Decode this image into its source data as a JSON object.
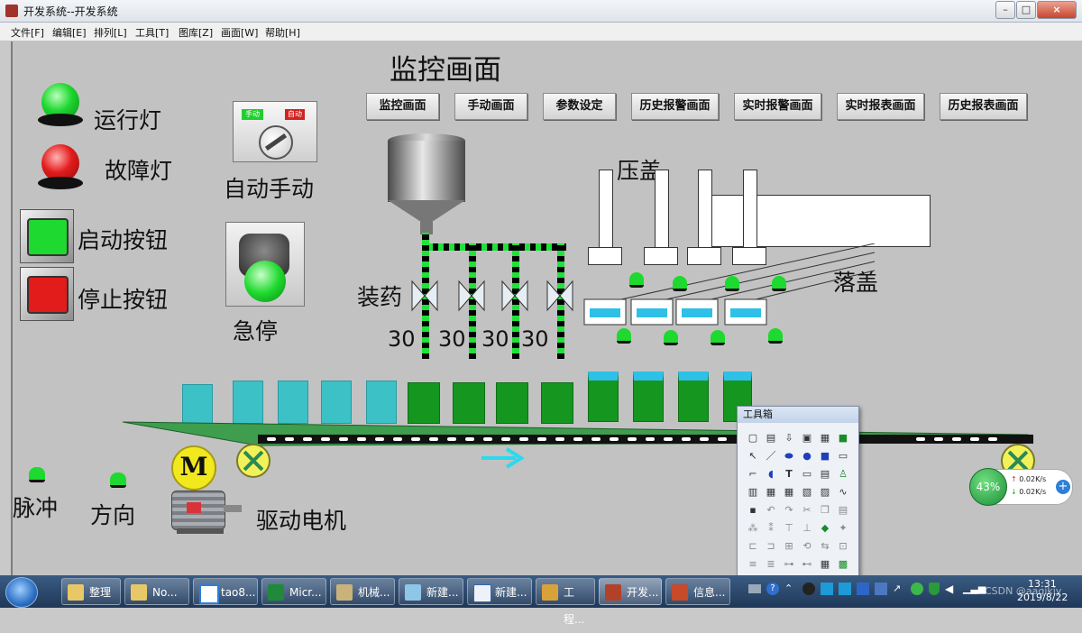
{
  "window": {
    "title": "开发系统--开发系统"
  },
  "menu": [
    "文件[F]",
    "编辑[E]",
    "排列[L]",
    "工具[T]",
    "图库[Z]",
    "画面[W]",
    "帮助[H]"
  ],
  "screen_title": "监控画面",
  "nav_buttons": [
    "监控画面",
    "手动画面",
    "参数设定",
    "历史报警画面",
    "实时报警画面",
    "实时报表画面",
    "历史报表画面"
  ],
  "lights": {
    "run": "运行灯",
    "fault": "故障灯"
  },
  "buttons": {
    "start": "启动按钮",
    "stop": "停止按钮"
  },
  "mode_switch": {
    "label": "自动手动",
    "manual_tag": "手动",
    "auto_tag": "自动"
  },
  "estop": "急停",
  "filling": {
    "label": "装药",
    "values": [
      "30",
      "30",
      "30",
      "30"
    ]
  },
  "press": "压盖",
  "drop_cap": "落盖",
  "motor": {
    "label": "驱动电机",
    "badge": "M"
  },
  "pulse": "脉冲",
  "direction": "方向",
  "toolbox": {
    "title": "工具箱"
  },
  "netspeed": {
    "percent": "43%",
    "up": "0.02K/s",
    "down": "0.02K/s"
  },
  "taskbar": {
    "items": [
      "整理",
      "No...",
      "tao8...",
      "Micr...",
      "机械...",
      "新建...",
      "新建...",
      "工程...",
      "开发...",
      "信息..."
    ],
    "time": "13:31",
    "date": "2019/8/22",
    "watermark": "CSDN @aaqikiy"
  },
  "colors": {
    "lamp_on": "#19d12c",
    "lamp_fault": "#e21b1b",
    "cyan": "#3cc2c6",
    "green": "#14961f"
  }
}
